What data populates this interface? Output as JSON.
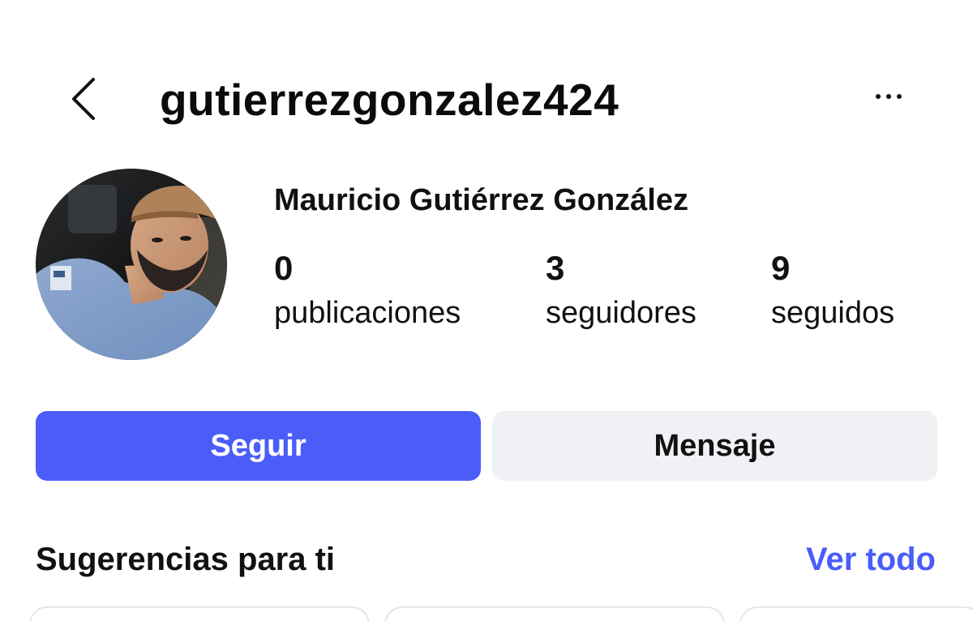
{
  "header": {
    "username": "gutierrezgonzalez424",
    "back_icon": "chevron-left-icon",
    "more_icon": "more-horizontal-icon"
  },
  "profile": {
    "full_name": "Mauricio Gutiérrez González",
    "stats": [
      {
        "value": "0",
        "label": "publicaciones"
      },
      {
        "value": "3",
        "label": "seguidores"
      },
      {
        "value": "9",
        "label": "seguidos"
      }
    ]
  },
  "actions": {
    "follow_label": "Seguir",
    "message_label": "Mensaje"
  },
  "suggestions": {
    "title": "Sugerencias para ti",
    "see_all_label": "Ver todo"
  },
  "colors": {
    "accent": "#4a5df9",
    "secondary_button": "#eff1f5"
  }
}
